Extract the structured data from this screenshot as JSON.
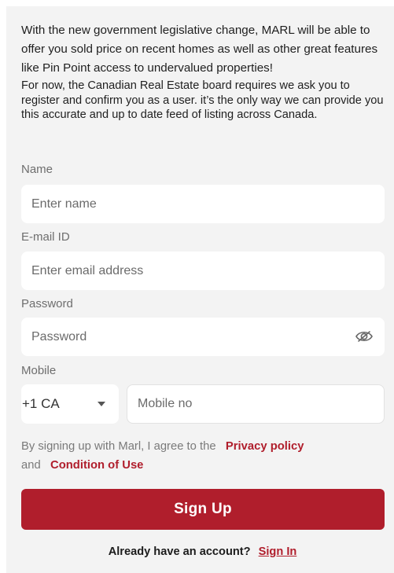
{
  "notice": {
    "intro": "With the new government legislative change, MARL will be able to offer you sold price on recent homes as well as other great features like Pin Point access to undervalued properties!",
    "requirement": "For now, the Canadian Real Estate board requires we ask you to register and confirm you as a user. it’s the only way we can provide you this accurate and up to date feed of listing across Canada."
  },
  "form": {
    "name": {
      "label": "Name",
      "placeholder": "Enter name"
    },
    "email": {
      "label": "E-mail ID",
      "placeholder": "Enter email address"
    },
    "password": {
      "label": "Password",
      "placeholder": "Password",
      "toggle_icon": "eye-off-icon"
    },
    "mobile": {
      "label": "Mobile",
      "country_code": "+1 CA",
      "placeholder": "Mobile no"
    }
  },
  "terms": {
    "prefix": "By signing up with Marl, I agree to the",
    "privacy_link": "Privacy policy",
    "conjunction": "and",
    "conditions_link": "Condition of Use"
  },
  "actions": {
    "signup_label": "Sign Up",
    "have_account_text": "Already have an account?",
    "signin_label": "Sign In"
  },
  "colors": {
    "accent": "#b01e2c",
    "panel_background": "#f3f3f3",
    "field_background": "#ffffff"
  }
}
